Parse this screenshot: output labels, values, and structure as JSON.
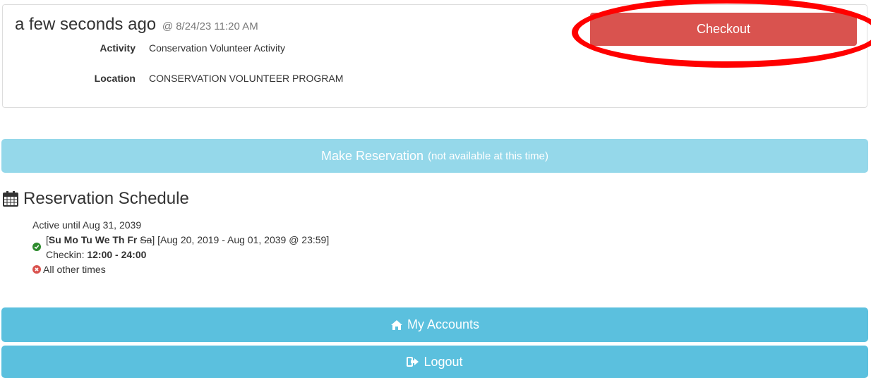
{
  "checkin": {
    "relative_time": "a few seconds ago",
    "timestamp": "@ 8/24/23 11:20 AM",
    "activity_label": "Activity",
    "activity_value": "Conservation Volunteer Activity",
    "location_label": "Location",
    "location_value": "CONSERVATION VOLUNTEER PROGRAM",
    "checkout_label": "Checkout"
  },
  "reservation": {
    "button_label": "Make Reservation",
    "button_note": "(not available at this time)"
  },
  "schedule": {
    "title": "Reservation Schedule",
    "active_until": "Active until Aug 31, 2039",
    "bracket_open": "[",
    "days_bold": "Su Mo Tu We Th Fr",
    "day_struck": "Sa",
    "bracket_close": "]",
    "date_range": "[Aug 20, 2019 - Aug 01, 2039 @ 23:59]",
    "checkin_label": "Checkin:",
    "checkin_time": "12:00 - 24:00",
    "other_times": "All other times"
  },
  "nav": {
    "my_accounts": "My Accounts",
    "logout": "Logout"
  },
  "colors": {
    "danger": "#d9534f",
    "info": "#5bc0de",
    "info_disabled": "#95d8ea",
    "highlight_ring": "#ff0000",
    "ok": "#2e8b2e",
    "error": "#d9534f"
  }
}
